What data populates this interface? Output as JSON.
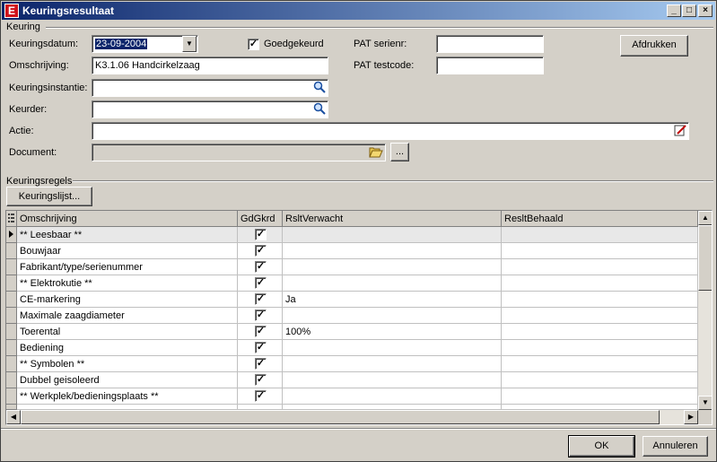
{
  "window": {
    "title": "Keuringsresultaat",
    "app_icon_letter": "E",
    "minimize": "_",
    "maximize": "□",
    "close": "×"
  },
  "keuring": {
    "group_label": "Keuring",
    "datum_label": "Keuringsdatum:",
    "datum_value": "23-09-2004",
    "goedgekeurd_label": "Goedgekeurd",
    "goedgekeurd_checked": "✓",
    "pat_serienr_label": "PAT serienr:",
    "pat_serienr_value": "",
    "pat_testcode_label": "PAT testcode:",
    "pat_testcode_value": "",
    "afdrukken_label": "Afdrukken",
    "omschrijving_label": "Omschrijving:",
    "omschrijving_value": "K3.1.06 Handcirkelzaag",
    "instantie_label": "Keuringsinstantie:",
    "instantie_value": "",
    "keurder_label": "Keurder:",
    "keurder_value": "",
    "actie_label": "Actie:",
    "actie_value": "",
    "document_label": "Document:",
    "document_value": "",
    "browse_label": "..."
  },
  "regels": {
    "group_label": "Keuringsregels",
    "keuringslijst_label": "Keuringslijst...",
    "columns": [
      "Omschrijving",
      "GdGkrd",
      "RsltVerwacht",
      "ResltBehaald"
    ],
    "rows": [
      {
        "omschrijving": "** Leesbaar **",
        "gdgkrd": "✓",
        "verwacht": "",
        "behaald": ""
      },
      {
        "omschrijving": "Bouwjaar",
        "gdgkrd": "✓",
        "verwacht": "",
        "behaald": ""
      },
      {
        "omschrijving": "Fabrikant/type/serienummer",
        "gdgkrd": "✓",
        "verwacht": "",
        "behaald": ""
      },
      {
        "omschrijving": "** Elektrokutie **",
        "gdgkrd": "✓",
        "verwacht": "",
        "behaald": ""
      },
      {
        "omschrijving": "CE-markering",
        "gdgkrd": "✓",
        "verwacht": "Ja",
        "behaald": ""
      },
      {
        "omschrijving": "Maximale zaagdiameter",
        "gdgkrd": "✓",
        "verwacht": "",
        "behaald": ""
      },
      {
        "omschrijving": "Toerental",
        "gdgkrd": "✓",
        "verwacht": "100%",
        "behaald": ""
      },
      {
        "omschrijving": "Bediening",
        "gdgkrd": "✓",
        "verwacht": "",
        "behaald": ""
      },
      {
        "omschrijving": "** Symbolen **",
        "gdgkrd": "✓",
        "verwacht": "",
        "behaald": ""
      },
      {
        "omschrijving": "Dubbel geisoleerd",
        "gdgkrd": "✓",
        "verwacht": "",
        "behaald": ""
      },
      {
        "omschrijving": "** Werkplek/bedieningsplaats **",
        "gdgkrd": "✓",
        "verwacht": "",
        "behaald": ""
      }
    ]
  },
  "footer": {
    "ok_label": "OK",
    "annuleren_label": "Annuleren"
  },
  "icons": {
    "search": "search-icon",
    "dropdown": "chevron-down-icon",
    "edit": "edit-icon",
    "folder": "folder-open-icon",
    "row_pointer": "row-pointer-icon"
  }
}
